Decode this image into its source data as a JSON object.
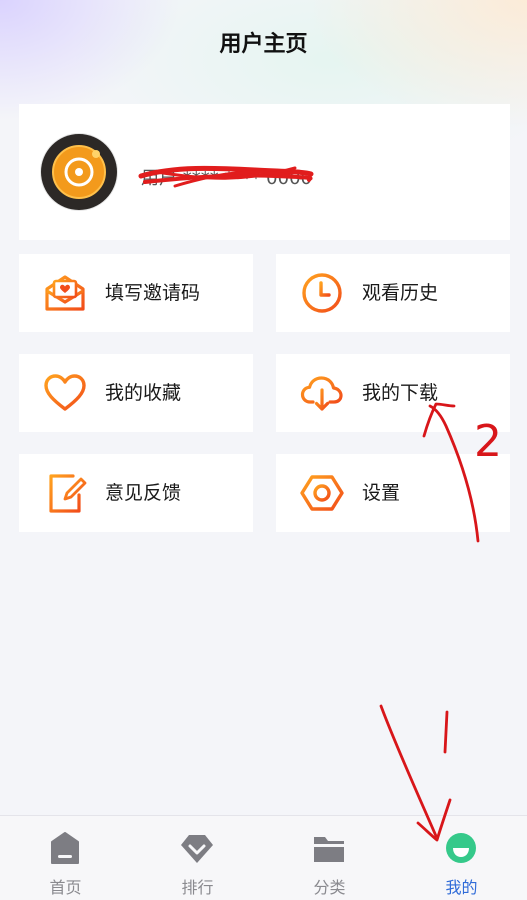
{
  "header": {
    "title": "用户主页"
  },
  "profile": {
    "username": "用户 **** **** 0000"
  },
  "menu": {
    "invite": "填写邀请码",
    "history": "观看历史",
    "favorites": "我的收藏",
    "downloads": "我的下载",
    "feedback": "意见反馈",
    "settings": "设置"
  },
  "annotations": {
    "step_number": "2",
    "mark": "1"
  },
  "tabbar": {
    "home": "首页",
    "ranking": "排行",
    "category": "分类",
    "mine": "我的",
    "active": "mine"
  },
  "colors": {
    "accent_orange": "#f56a1c",
    "active_tab": "#2f6bd8",
    "active_tab_icon": "#35c98a",
    "annotation_red": "#d8161a"
  }
}
